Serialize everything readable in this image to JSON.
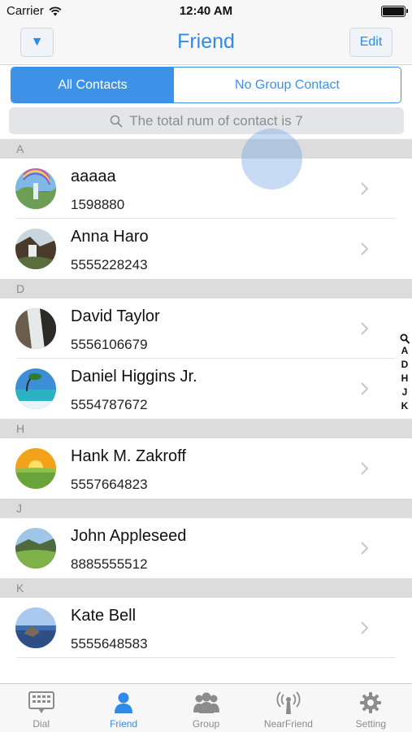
{
  "status_bar": {
    "carrier": "Carrier",
    "time": "12:40 AM"
  },
  "nav": {
    "title": "Friend",
    "edit_label": "Edit",
    "menu_glyph": "▼"
  },
  "segmented": {
    "all_label": "All Contacts",
    "no_group_label": "No Group Contact",
    "selected": "All Contacts"
  },
  "search": {
    "placeholder": "The total num of contact is 7",
    "icon": "search-icon"
  },
  "sections": [
    {
      "letter": "A",
      "contacts": [
        {
          "name": "aaaaa",
          "phone": "1598880",
          "avatar": "waterfall-rainbow"
        },
        {
          "name": "Anna Haro",
          "phone": "5555228243",
          "avatar": "cliff-falls"
        }
      ]
    },
    {
      "letter": "D",
      "contacts": [
        {
          "name": "David Taylor",
          "phone": "5556106679",
          "avatar": "waterfall"
        },
        {
          "name": "Daniel Higgins Jr.",
          "phone": "5554787672",
          "avatar": "tropical-lagoon"
        }
      ]
    },
    {
      "letter": "H",
      "contacts": [
        {
          "name": "Hank M. Zakroff",
          "phone": "5557664823",
          "avatar": "sunset-field"
        }
      ]
    },
    {
      "letter": "J",
      "contacts": [
        {
          "name": "John Appleseed",
          "phone": "8885555512",
          "avatar": "green-hills"
        }
      ]
    },
    {
      "letter": "K",
      "contacts": [
        {
          "name": "Kate Bell",
          "phone": "5555648583",
          "avatar": "lake-rock"
        }
      ]
    }
  ],
  "index": [
    "A",
    "D",
    "H",
    "J",
    "K"
  ],
  "tabs": [
    {
      "label": "Dial",
      "icon": "dialpad-icon",
      "active": false
    },
    {
      "label": "Friend",
      "icon": "person-icon",
      "active": true
    },
    {
      "label": "Group",
      "icon": "group-icon",
      "active": false
    },
    {
      "label": "NearFriend",
      "icon": "antenna-icon",
      "active": false
    },
    {
      "label": "Setting",
      "icon": "gear-icon",
      "active": false
    }
  ],
  "colors": {
    "accent": "#2f8be8",
    "section_bg": "#dcdcdc",
    "tab_inactive": "#8c8c8c"
  }
}
